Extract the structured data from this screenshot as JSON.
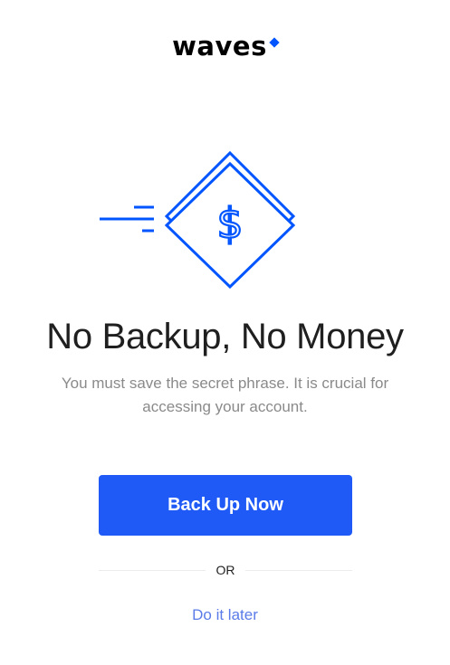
{
  "brand": {
    "logo_text": "waves",
    "accent_color": "#0055ff"
  },
  "illustration": {
    "icon": "money-diamond-icon",
    "symbol": "$"
  },
  "content": {
    "title": "No Backup, No Money",
    "subtitle": "You must save the secret phrase. It is crucial for accessing your account."
  },
  "actions": {
    "primary_label": "Back Up Now",
    "primary_color": "#1f5af6",
    "divider_label": "OR",
    "secondary_label": "Do it later",
    "secondary_color": "#5a7be8"
  }
}
